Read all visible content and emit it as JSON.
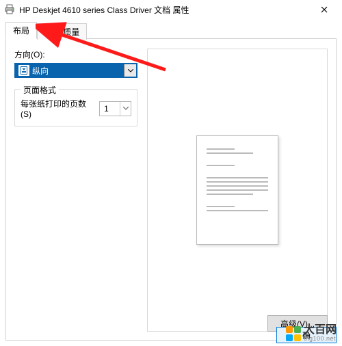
{
  "window": {
    "title": "HP Deskjet 4610 series Class Driver 文档 属性"
  },
  "tabs": {
    "layout": "布局",
    "paper_quality": "纸张/质量"
  },
  "orientation": {
    "label": "方向(O):",
    "value": "纵向"
  },
  "page_format": {
    "legend": "页面格式",
    "pages_per_sheet_label": "每张纸打印的页数(S)",
    "pages_per_sheet_value": "1"
  },
  "buttons": {
    "advanced": "高级(V)...",
    "ok": "确"
  },
  "watermark": {
    "brand": "大百网",
    "domain": "big100.net"
  },
  "colors": {
    "accent": "#0a64ad",
    "arrow": "#ff1a1a"
  }
}
